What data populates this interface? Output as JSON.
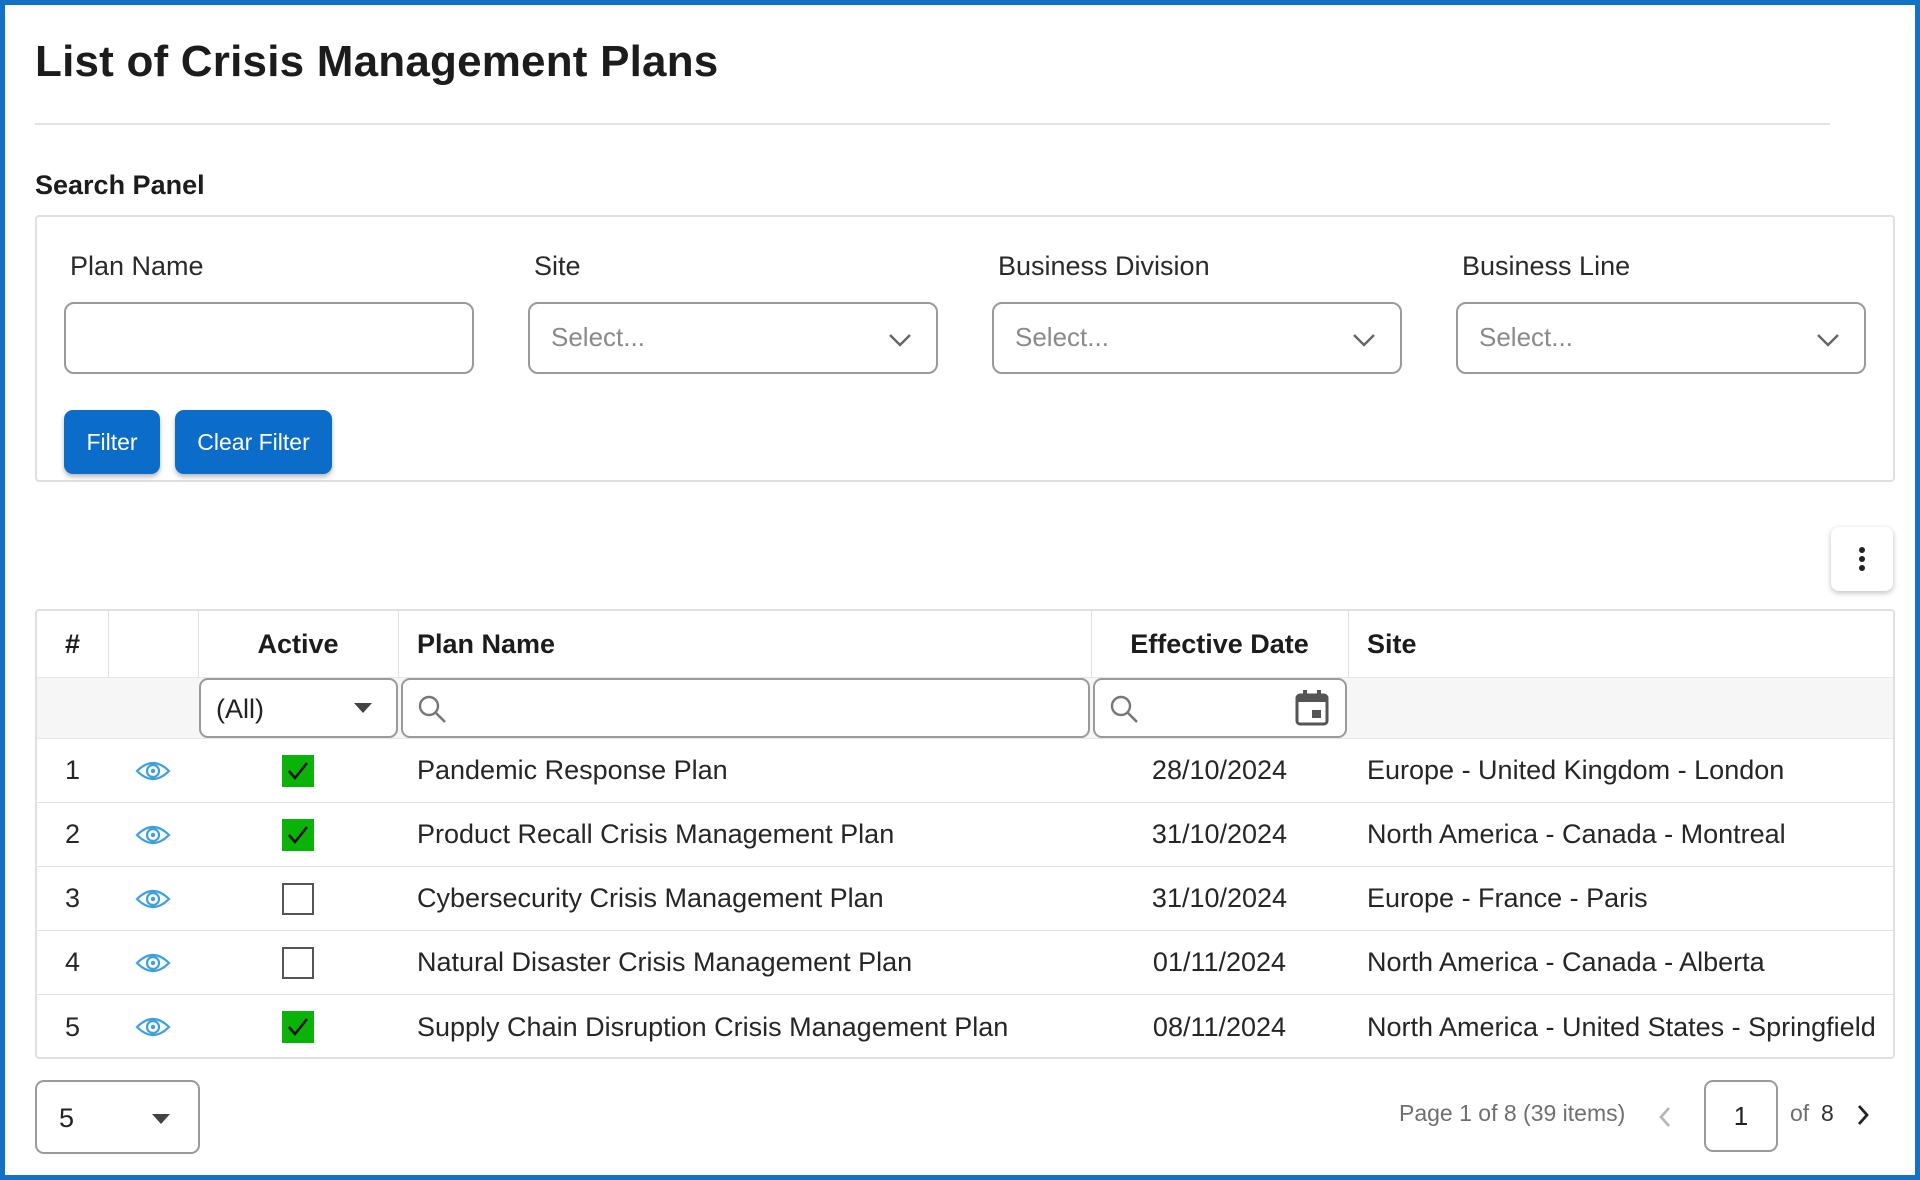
{
  "page": {
    "title": "List of Crisis Management Plans",
    "search_panel_label": "Search Panel"
  },
  "search": {
    "fields": [
      {
        "label": "Plan Name",
        "value": ""
      },
      {
        "label": "Site",
        "placeholder": "Select..."
      },
      {
        "label": "Business Division",
        "placeholder": "Select..."
      },
      {
        "label": "Business Line",
        "placeholder": "Select..."
      }
    ],
    "filter_label": "Filter",
    "clear_label": "Clear Filter"
  },
  "grid": {
    "columns": [
      "#",
      "",
      "Active",
      "Plan Name",
      "Effective Date",
      "Site"
    ],
    "active_filter_value": "(All)",
    "rows": [
      {
        "num": "1",
        "active": true,
        "plan_name": "Pandemic Response Plan",
        "effective_date": "28/10/2024",
        "site": "Europe - United Kingdom - London"
      },
      {
        "num": "2",
        "active": true,
        "plan_name": "Product Recall Crisis Management Plan",
        "effective_date": "31/10/2024",
        "site": "North America - Canada - Montreal"
      },
      {
        "num": "3",
        "active": false,
        "plan_name": "Cybersecurity Crisis Management Plan",
        "effective_date": "31/10/2024",
        "site": "Europe - France - Paris"
      },
      {
        "num": "4",
        "active": false,
        "plan_name": "Natural Disaster Crisis Management Plan",
        "effective_date": "01/11/2024",
        "site": "North America - Canada - Alberta"
      },
      {
        "num": "5",
        "active": true,
        "plan_name": "Supply Chain Disruption Crisis Management Plan",
        "effective_date": "08/11/2024",
        "site": "North America - United States - Springfield"
      }
    ]
  },
  "pager": {
    "page_size": "5",
    "info": "Page 1 of 8 (39 items)",
    "current_page": "1",
    "of_label": "of",
    "total_pages": "8"
  },
  "colors": {
    "accent": "#0b6cc9",
    "frame": "#1272c6",
    "active_check": "#09b309",
    "eye_icon": "#3ea0e0"
  },
  "icons": [
    "chevron-down-icon",
    "kebab-menu-icon",
    "eye-icon",
    "search-icon",
    "calendar-icon",
    "caret-down-icon",
    "chevron-left-icon",
    "chevron-right-icon",
    "checkmark-icon"
  ]
}
